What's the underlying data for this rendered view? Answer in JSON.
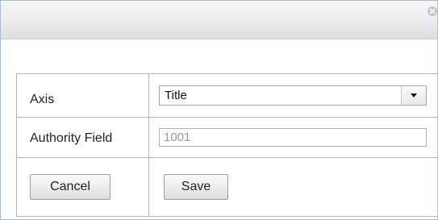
{
  "dialog": {
    "close_icon": "close-circle-icon"
  },
  "form": {
    "axis": {
      "label": "Axis",
      "selected_value": "Title",
      "dropdown_icon": "triangle-down-icon"
    },
    "authority_field": {
      "label": "Authority Field",
      "value": "1001"
    },
    "actions": {
      "cancel_label": "Cancel",
      "save_label": "Save"
    }
  }
}
